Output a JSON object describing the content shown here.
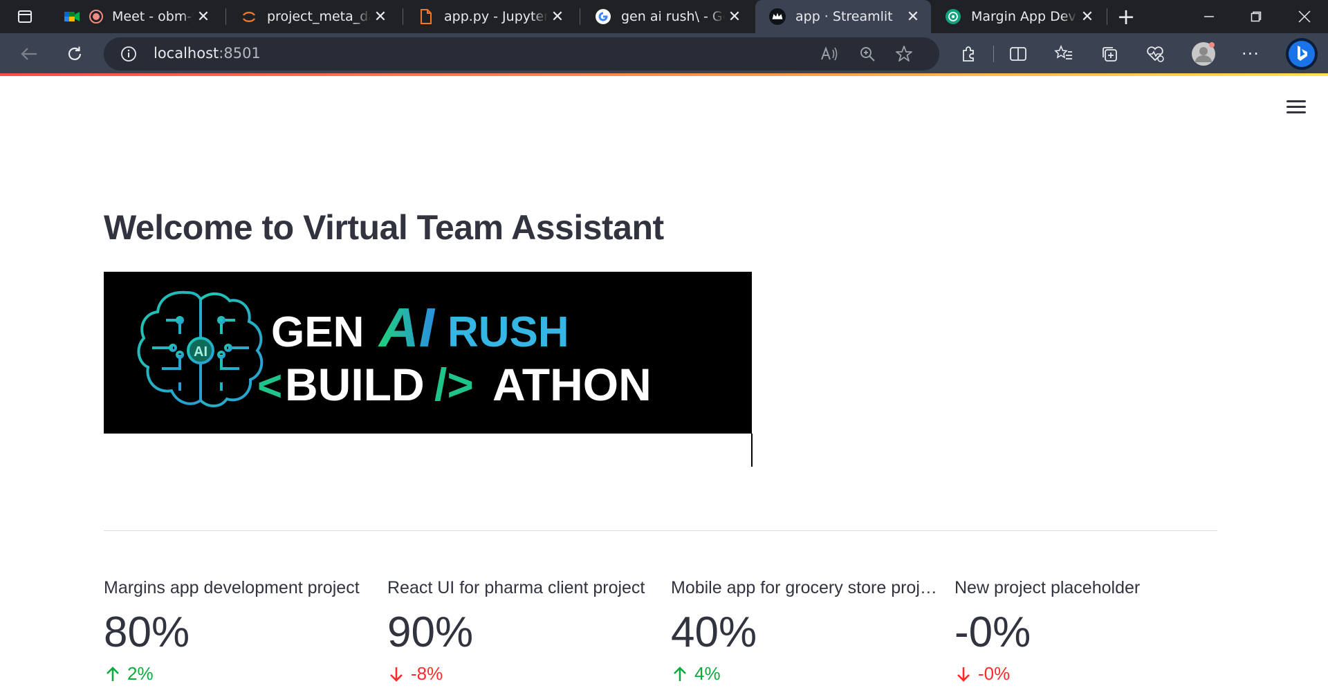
{
  "browser": {
    "tabs": [
      {
        "title": "Meet - obm-yd",
        "icon": "google-meet-icon",
        "recording": true
      },
      {
        "title": "project_meta_data/",
        "icon": "jupyter-icon"
      },
      {
        "title": "app.py - Jupyter Tex",
        "icon": "file-icon"
      },
      {
        "title": "gen ai rush\\ - Goog",
        "icon": "google-icon"
      },
      {
        "title": "app · Streamlit",
        "icon": "streamlit-icon",
        "active": true
      },
      {
        "title": "Margin App Dev Pro",
        "icon": "chatgpt-icon"
      }
    ],
    "address": {
      "host": "localhost",
      "port": ":8501"
    }
  },
  "page": {
    "title": "Welcome to Virtual Team Assistant",
    "banner": {
      "line1_a": "GEN",
      "line1_ai": "AI",
      "line1_b": "RUSH",
      "line2_lt": "<",
      "line2_build": "BUILD",
      "line2_slash": "/>",
      "line2_athon": "ATHON",
      "brain_badge": "AI"
    },
    "metrics": [
      {
        "label": "Margins app development project",
        "value": "80%",
        "delta": "2%",
        "direction": "up"
      },
      {
        "label": "React UI for pharma client project",
        "value": "90%",
        "delta": "-8%",
        "direction": "down"
      },
      {
        "label": "Mobile app for grocery store project",
        "value": "40%",
        "delta": "4%",
        "direction": "up"
      },
      {
        "label": "New project placeholder",
        "value": "-0%",
        "delta": "-0%",
        "direction": "down"
      }
    ]
  },
  "colors": {
    "up": "#09ab3b",
    "down": "#ff2b2b",
    "brand": "#ff4b4b"
  }
}
